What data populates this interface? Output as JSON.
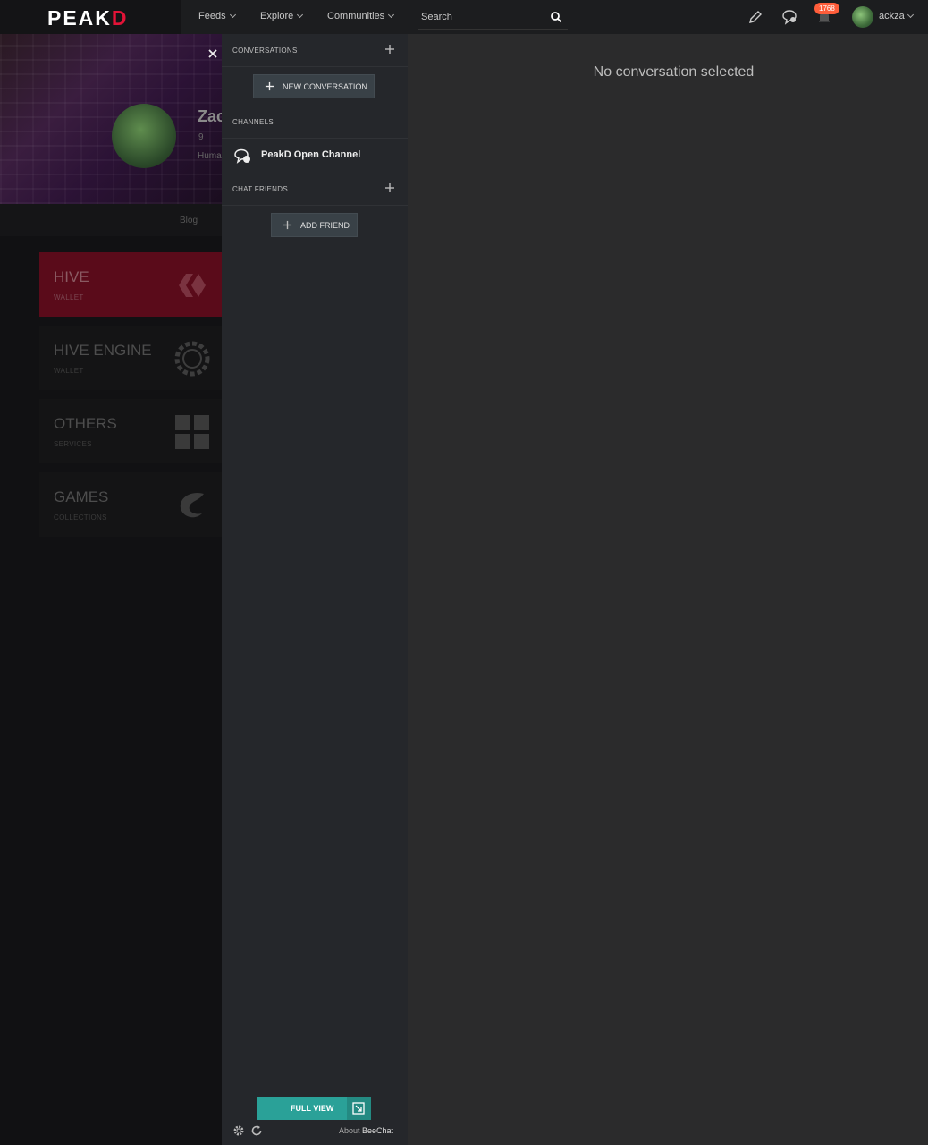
{
  "nav": {
    "logo_prefix": "PEAK",
    "logo_suffix": "D",
    "feeds": "Feeds",
    "explore": "Explore",
    "communities": "Communities",
    "search_placeholder": "Search",
    "notifications_count": "1768",
    "username": "ackza"
  },
  "background": {
    "profile_name": "Zac",
    "profile_sub1": "9",
    "profile_sub2": "Huma",
    "tab_blog": "Blog",
    "cards": [
      {
        "title": "HIVE",
        "subtitle": "WALLET"
      },
      {
        "title": "HIVE ENGINE",
        "subtitle": "WALLET"
      },
      {
        "title": "OTHERS",
        "subtitle": "SERVICES"
      },
      {
        "title": "GAMES",
        "subtitle": "COLLECTIONS"
      }
    ]
  },
  "chat": {
    "conversations_header": "CONVERSATIONS",
    "new_conversation": "NEW CONVERSATION",
    "channels_header": "CHANNELS",
    "channel_name": "PeakD Open Channel",
    "chat_friends_header": "CHAT FRIENDS",
    "add_friend": "ADD FRIEND",
    "full_view": "FULL VIEW",
    "about_prefix": "About ",
    "about_brand": "BeeChat"
  },
  "main": {
    "empty_message": "No conversation selected"
  },
  "colors": {
    "accent_teal": "#2aa198",
    "brand_red": "#e31337",
    "badge_orange": "#ff5d3a"
  }
}
